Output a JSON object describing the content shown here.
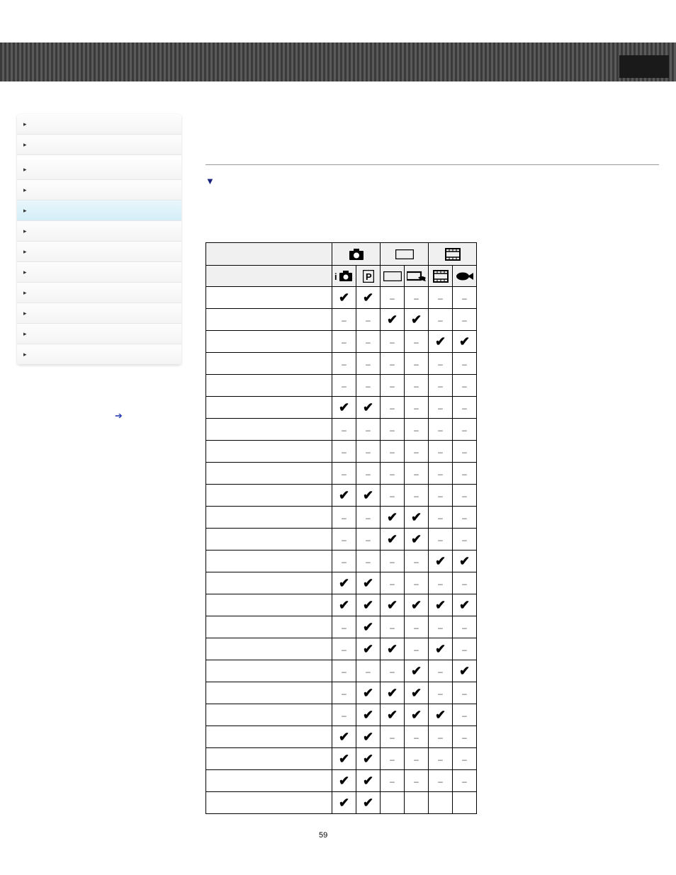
{
  "page_number": "59",
  "sidebar": {
    "items": [
      {
        "label": ""
      },
      {
        "label": ""
      },
      {
        "label": ""
      },
      {
        "label": ""
      },
      {
        "label": ""
      },
      {
        "label": ""
      },
      {
        "label": ""
      },
      {
        "label": ""
      },
      {
        "label": ""
      },
      {
        "label": ""
      },
      {
        "label": ""
      },
      {
        "label": ""
      }
    ]
  },
  "content": {
    "subhead": ""
  },
  "table_header_groups": [
    "still",
    "panorama",
    "movie"
  ],
  "table_sub_cols": [
    "intelligent-auto",
    "program-auto",
    "sweep",
    "sweep-underwater",
    "movie",
    "underwater-movie"
  ],
  "chart_data": {
    "type": "table",
    "columns": [
      "iAuto",
      "P",
      "Sweep",
      "SweepUW",
      "Movie",
      "MovieUW"
    ],
    "rows": [
      {
        "label": "",
        "cells": [
          "v",
          "v",
          "-",
          "-",
          "-",
          "-"
        ]
      },
      {
        "label": "",
        "cells": [
          "-",
          "-",
          "v",
          "v",
          "-",
          "-"
        ]
      },
      {
        "label": "",
        "cells": [
          "-",
          "-",
          "-",
          "-",
          "v",
          "v"
        ]
      },
      {
        "label": "",
        "cells": [
          "-",
          "-",
          "-",
          "-",
          "-",
          "-"
        ]
      },
      {
        "label": "",
        "cells": [
          "-",
          "-",
          "-",
          "-",
          "-",
          "-"
        ]
      },
      {
        "label": "",
        "cells": [
          "v",
          "v",
          "-",
          "-",
          "-",
          "-"
        ]
      },
      {
        "label": "",
        "cells": [
          "-",
          "-",
          "-",
          "-",
          "-",
          "-"
        ]
      },
      {
        "label": "",
        "cells": [
          "-",
          "-",
          "-",
          "-",
          "-",
          "-"
        ]
      },
      {
        "label": "",
        "cells": [
          "-",
          "-",
          "-",
          "-",
          "-",
          "-"
        ]
      },
      {
        "label": "",
        "cells": [
          "v",
          "v",
          "-",
          "-",
          "-",
          "-"
        ]
      },
      {
        "label": "",
        "cells": [
          "-",
          "-",
          "v",
          "v",
          "-",
          "-"
        ]
      },
      {
        "label": "",
        "cells": [
          "-",
          "-",
          "v",
          "v",
          "-",
          "-"
        ]
      },
      {
        "label": "",
        "cells": [
          "-",
          "-",
          "-",
          "-",
          "v",
          "v"
        ]
      },
      {
        "label": "",
        "cells": [
          "v",
          "v",
          "-",
          "-",
          "-",
          "-"
        ]
      },
      {
        "label": "",
        "cells": [
          "v",
          "v",
          "v",
          "v",
          "v",
          "v"
        ]
      },
      {
        "label": "",
        "cells": [
          "-",
          "v",
          "-",
          "-",
          "-",
          "-"
        ]
      },
      {
        "label": "",
        "cells": [
          "-",
          "v",
          "v",
          "-",
          "v",
          "-"
        ]
      },
      {
        "label": "",
        "cells": [
          "-",
          "-",
          "-",
          "v",
          "-",
          "v"
        ]
      },
      {
        "label": "",
        "cells": [
          "-",
          "v",
          "v",
          "v",
          "-",
          "-"
        ]
      },
      {
        "label": "",
        "cells": [
          "-",
          "v",
          "v",
          "v",
          "v",
          "-"
        ]
      },
      {
        "label": "",
        "cells": [
          "v",
          "v",
          "-",
          "-",
          "-",
          "-"
        ]
      },
      {
        "label": "",
        "cells": [
          "v",
          "v",
          "-",
          "-",
          "-",
          "-"
        ]
      },
      {
        "label": "",
        "cells": [
          "v",
          "v",
          "-",
          "-",
          "-",
          "-"
        ]
      },
      {
        "label": "",
        "cells": [
          "v",
          "v",
          "",
          "",
          "",
          ""
        ]
      }
    ]
  }
}
